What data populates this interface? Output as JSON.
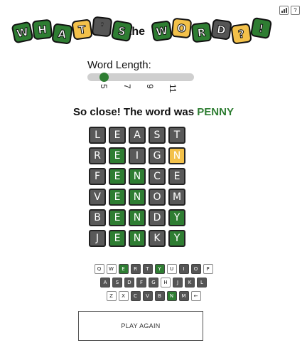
{
  "header": {
    "icons": [
      "stats-icon",
      "help-icon"
    ],
    "help_label": "?"
  },
  "logo": {
    "letters": [
      {
        "ch": "W",
        "color": "green"
      },
      {
        "ch": "H",
        "color": "green"
      },
      {
        "ch": "A",
        "color": "green"
      },
      {
        "ch": "T",
        "color": "yellow"
      },
      {
        "ch": "'",
        "color": "dark"
      },
      {
        "ch": "S",
        "color": "green"
      },
      {
        "ch": "W",
        "color": "green"
      },
      {
        "ch": "O",
        "color": "yellow"
      },
      {
        "ch": "R",
        "color": "green"
      },
      {
        "ch": "D",
        "color": "dark"
      },
      {
        "ch": "?",
        "color": "yellow"
      },
      {
        "ch": "!",
        "color": "green"
      }
    ],
    "middle_text": "the"
  },
  "settings": {
    "word_length_label": "Word Length:",
    "word_length_value": 5,
    "ticks": [
      "5",
      "7",
      "9",
      "11"
    ]
  },
  "message": {
    "prefix": "So close! The word was ",
    "answer": "PENNY"
  },
  "board": [
    [
      {
        "l": "L",
        "s": "absent"
      },
      {
        "l": "E",
        "s": "absent"
      },
      {
        "l": "A",
        "s": "absent"
      },
      {
        "l": "S",
        "s": "absent"
      },
      {
        "l": "T",
        "s": "absent"
      }
    ],
    [
      {
        "l": "R",
        "s": "absent"
      },
      {
        "l": "E",
        "s": "correct"
      },
      {
        "l": "I",
        "s": "absent"
      },
      {
        "l": "G",
        "s": "absent"
      },
      {
        "l": "N",
        "s": "present"
      }
    ],
    [
      {
        "l": "F",
        "s": "absent"
      },
      {
        "l": "E",
        "s": "correct"
      },
      {
        "l": "N",
        "s": "correct"
      },
      {
        "l": "C",
        "s": "absent"
      },
      {
        "l": "E",
        "s": "absent"
      }
    ],
    [
      {
        "l": "V",
        "s": "absent"
      },
      {
        "l": "E",
        "s": "correct"
      },
      {
        "l": "N",
        "s": "correct"
      },
      {
        "l": "O",
        "s": "absent"
      },
      {
        "l": "M",
        "s": "absent"
      }
    ],
    [
      {
        "l": "B",
        "s": "absent"
      },
      {
        "l": "E",
        "s": "correct"
      },
      {
        "l": "N",
        "s": "correct"
      },
      {
        "l": "D",
        "s": "absent"
      },
      {
        "l": "Y",
        "s": "correct"
      }
    ],
    [
      {
        "l": "J",
        "s": "absent"
      },
      {
        "l": "E",
        "s": "correct"
      },
      {
        "l": "N",
        "s": "correct"
      },
      {
        "l": "K",
        "s": "absent"
      },
      {
        "l": "Y",
        "s": "correct"
      }
    ]
  ],
  "keyboard": [
    [
      {
        "k": "Q",
        "s": "unused"
      },
      {
        "k": "W",
        "s": "unused"
      },
      {
        "k": "E",
        "s": "correct"
      },
      {
        "k": "R",
        "s": "absent"
      },
      {
        "k": "T",
        "s": "absent"
      },
      {
        "k": "Y",
        "s": "correct"
      },
      {
        "k": "U",
        "s": "unused"
      },
      {
        "k": "I",
        "s": "absent"
      },
      {
        "k": "O",
        "s": "absent"
      },
      {
        "k": "P",
        "s": "unused"
      }
    ],
    [
      {
        "k": "A",
        "s": "absent"
      },
      {
        "k": "S",
        "s": "absent"
      },
      {
        "k": "D",
        "s": "absent"
      },
      {
        "k": "F",
        "s": "absent"
      },
      {
        "k": "G",
        "s": "absent"
      },
      {
        "k": "H",
        "s": "unused"
      },
      {
        "k": "J",
        "s": "absent"
      },
      {
        "k": "K",
        "s": "absent"
      },
      {
        "k": "L",
        "s": "absent"
      }
    ],
    [
      {
        "k": "Z",
        "s": "unused"
      },
      {
        "k": "X",
        "s": "unused"
      },
      {
        "k": "C",
        "s": "absent"
      },
      {
        "k": "V",
        "s": "absent"
      },
      {
        "k": "B",
        "s": "absent"
      },
      {
        "k": "N",
        "s": "correct"
      },
      {
        "k": "M",
        "s": "absent"
      },
      {
        "k": "←",
        "s": "unused"
      }
    ]
  ],
  "play_again_label": "PLAY AGAIN",
  "colors": {
    "green": "#2e7d32",
    "yellow": "#f3c14a",
    "dark": "#555555"
  }
}
